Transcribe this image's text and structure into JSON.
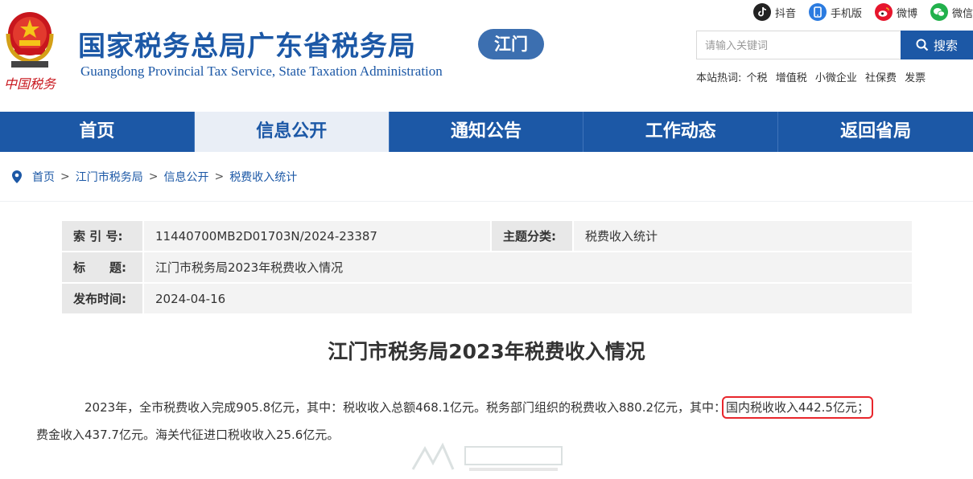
{
  "header": {
    "emblem_caption": "中国税务",
    "title": "国家税务总局广东省税务局",
    "subtitle": "Guangdong Provincial Tax Service, State Taxation Administration",
    "city_badge": "江门"
  },
  "social": [
    {
      "label": "抖音",
      "icon": "tiktok-icon"
    },
    {
      "label": "手机版",
      "icon": "mobile-icon"
    },
    {
      "label": "微博",
      "icon": "weibo-icon"
    },
    {
      "label": "微信",
      "icon": "wechat-icon"
    }
  ],
  "search": {
    "placeholder": "请输入关键词",
    "button_label": "搜索",
    "hot_label": "本站热词:",
    "hot_words": [
      "个税",
      "增值税",
      "小微企业",
      "社保费",
      "发票"
    ]
  },
  "nav": {
    "items": [
      "首页",
      "信息公开",
      "通知公告",
      "工作动态",
      "返回省局"
    ],
    "active_index": 1
  },
  "breadcrumb": [
    "首页",
    "江门市税务局",
    "信息公开",
    "税费收入统计"
  ],
  "info": {
    "index_label": "索 引 号:",
    "index_value": "11440700MB2D01703N/2024-23387",
    "category_label": "主题分类:",
    "category_value": "税费收入统计",
    "title_label": "标　　题:",
    "title_value": "江门市税务局2023年税费收入情况",
    "date_label": "发布时间:",
    "date_value": "2024-04-16"
  },
  "article": {
    "title": "江门市税务局2023年税费收入情况",
    "body_part1": "2023年，全市税费收入完成905.8亿元，其中：税收收入总额468.1亿元。税务部门组织的税费收入880.2亿元，其中：",
    "body_highlight": "国内税收收入442.5亿元；",
    "body_part2": "费金收入437.7亿元。海关代征进口税收收入25.6亿元。"
  },
  "colors": {
    "brand_blue": "#1c58a6",
    "highlight_red": "#e8262c"
  }
}
